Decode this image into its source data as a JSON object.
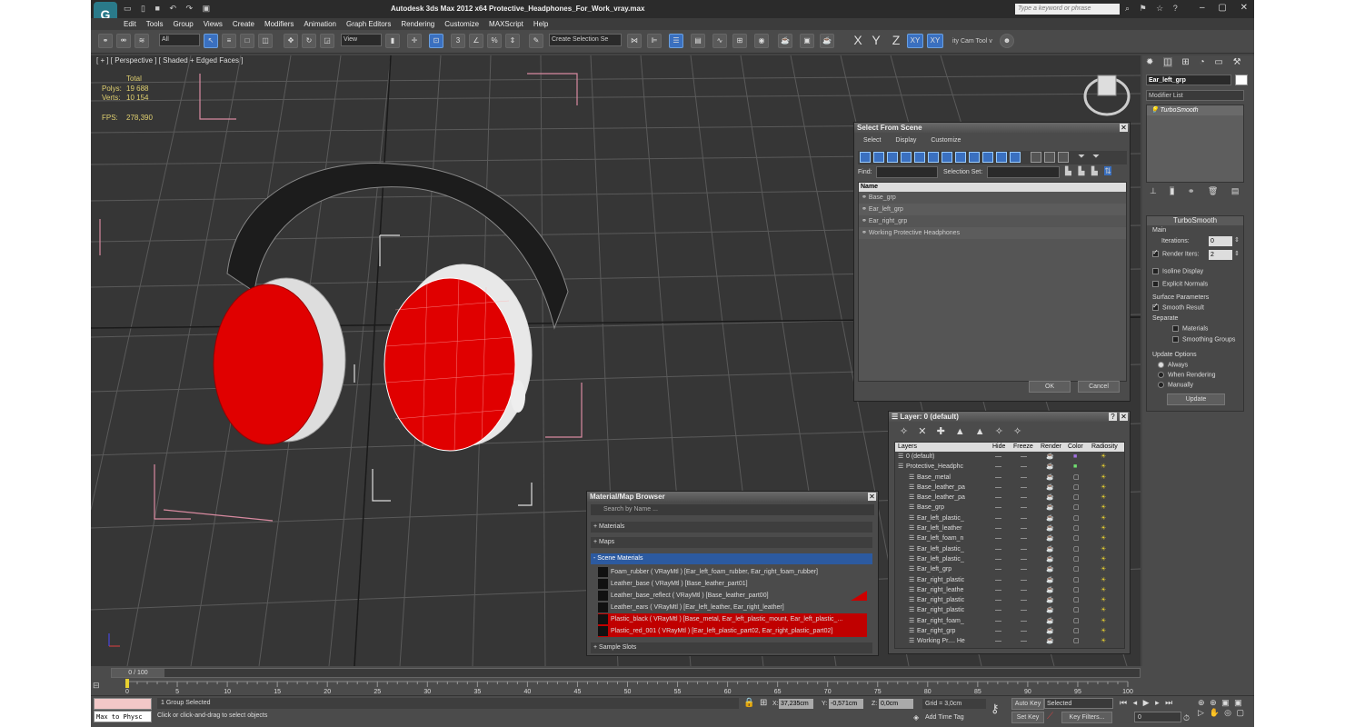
{
  "window": {
    "title": "Autodesk 3ds Max  2012 x64     Protective_Headphones_For_Work_vray.max",
    "search_placeholder": "Type a keyword or phrase"
  },
  "menu": [
    "Edit",
    "Tools",
    "Group",
    "Views",
    "Create",
    "Modifiers",
    "Animation",
    "Graph Editors",
    "Rendering",
    "Customize",
    "MAXScript",
    "Help"
  ],
  "toolbar": {
    "filter": "All",
    "refcoord": "View",
    "selection_set": "Create Selection Se",
    "axes": [
      "X",
      "Y",
      "Z",
      "XY",
      "XY"
    ],
    "cam_tool": "ity Cam Tool v"
  },
  "viewport": {
    "label": "[ + ] [ Perspective ] [ Shaded + Edged Faces ]",
    "stats_header": "Total",
    "polys_label": "Polys:",
    "polys": "19 688",
    "verts_label": "Verts:",
    "verts": "10 154",
    "fps_label": "FPS:",
    "fps": "278,390"
  },
  "select_dialog": {
    "title": "Select From Scene",
    "menu": [
      "Select",
      "Display",
      "Customize"
    ],
    "find_label": "Find:",
    "selset_label": "Selection Set:",
    "col_name": "Name",
    "items": [
      "Base_grp",
      "Ear_left_grp",
      "Ear_right_grp",
      "Working Protective Headphones"
    ],
    "ok": "OK",
    "cancel": "Cancel"
  },
  "layer_dialog": {
    "title": "Layer: 0 (default)",
    "cols": [
      "Layers",
      "Hide",
      "Freeze",
      "Render",
      "Color",
      "Radiosity"
    ],
    "rows": [
      "0 (default)",
      "Protective_Headphc",
      "Base_metal",
      "Base_leather_pa",
      "Base_leather_pa",
      "Base_grp",
      "Ear_left_plastic_",
      "Ear_left_leather",
      "Ear_left_foam_n",
      "Ear_left_plastic_",
      "Ear_left_plastic_",
      "Ear_left_grp",
      "Ear_right_plastic",
      "Ear_right_leathe",
      "Ear_right_plastic",
      "Ear_right_plastic",
      "Ear_right_foam_",
      "Ear_right_grp",
      "Working Pr.... He"
    ]
  },
  "material_browser": {
    "title": "Material/Map Browser",
    "search": "Search by Name ...",
    "groups": [
      "+ Materials",
      "+ Maps",
      "- Scene Materials",
      "+ Sample Slots"
    ],
    "materials": [
      "Foam_rubber  ( VRayMtl ) [Ear_left_foam_rubber, Ear_right_foam_rubber]",
      "Leather_base  ( VRayMtl ) [Base_leather_part01]",
      "Leather_base_reflect  ( VRayMtl ) [Base_leather_part00]",
      "Leather_ears  ( VRayMtl ) [Ear_left_leather, Ear_right_leather]",
      "Plastic_black  ( VRayMtl ) [Base_metal, Ear_left_plastic_mount, Ear_left_plastic_...",
      "Plastic_red_001  ( VRayMtl ) [Ear_left_plastic_part02, Ear_right_plastic_part02]"
    ]
  },
  "command_panel": {
    "object_name": "Ear_left_grp",
    "modifier_list": "Modifier List",
    "stack_item": "TurboSmooth",
    "rollout": "TurboSmooth",
    "main": "Main",
    "iterations_label": "Iterations:",
    "iterations": "0",
    "render_iters_label": "Render Iters:",
    "render_iters": "2",
    "isoline": "Isoline Display",
    "explicit": "Explicit Normals",
    "surface": "Surface Parameters",
    "smooth_result": "Smooth Result",
    "separate": "Separate",
    "materials": "Materials",
    "smoothing_groups": "Smoothing Groups",
    "update_options": "Update Options",
    "always": "Always",
    "when_rendering": "When Rendering",
    "manually": "Manually",
    "update": "Update"
  },
  "timeline": {
    "frame": "0 / 100",
    "ticks": [
      "0",
      "5",
      "10",
      "15",
      "20",
      "25",
      "30",
      "35",
      "40",
      "45",
      "50",
      "55",
      "60",
      "65",
      "70",
      "75",
      "80",
      "85",
      "90",
      "95",
      "100"
    ]
  },
  "status": {
    "maxscript": "Max to Physc",
    "selected": "1 Group Selected",
    "prompt": "Click or click-and-drag to select objects",
    "x_label": "X:",
    "x": "37,235cm",
    "y_label": "Y:",
    "y": "-0,571cm",
    "z_label": "Z:",
    "z": "0,0cm",
    "grid": "Grid = 3,0cm",
    "add_time_tag": "Add Time Tag",
    "auto_key": "Auto Key",
    "set_key": "Set Key",
    "selected_dd": "Selected",
    "key_filters": "Key Filters...",
    "frame": "0"
  }
}
